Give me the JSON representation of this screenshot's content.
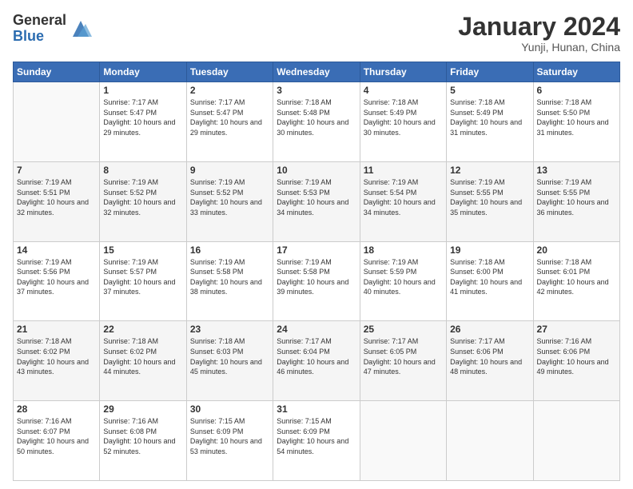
{
  "header": {
    "logo_general": "General",
    "logo_blue": "Blue",
    "month_title": "January 2024",
    "location": "Yunji, Hunan, China"
  },
  "calendar": {
    "days_of_week": [
      "Sunday",
      "Monday",
      "Tuesday",
      "Wednesday",
      "Thursday",
      "Friday",
      "Saturday"
    ],
    "weeks": [
      [
        {
          "day": "",
          "sunrise": "",
          "sunset": "",
          "daylight": ""
        },
        {
          "day": "1",
          "sunrise": "Sunrise: 7:17 AM",
          "sunset": "Sunset: 5:47 PM",
          "daylight": "Daylight: 10 hours and 29 minutes."
        },
        {
          "day": "2",
          "sunrise": "Sunrise: 7:17 AM",
          "sunset": "Sunset: 5:47 PM",
          "daylight": "Daylight: 10 hours and 29 minutes."
        },
        {
          "day": "3",
          "sunrise": "Sunrise: 7:18 AM",
          "sunset": "Sunset: 5:48 PM",
          "daylight": "Daylight: 10 hours and 30 minutes."
        },
        {
          "day": "4",
          "sunrise": "Sunrise: 7:18 AM",
          "sunset": "Sunset: 5:49 PM",
          "daylight": "Daylight: 10 hours and 30 minutes."
        },
        {
          "day": "5",
          "sunrise": "Sunrise: 7:18 AM",
          "sunset": "Sunset: 5:49 PM",
          "daylight": "Daylight: 10 hours and 31 minutes."
        },
        {
          "day": "6",
          "sunrise": "Sunrise: 7:18 AM",
          "sunset": "Sunset: 5:50 PM",
          "daylight": "Daylight: 10 hours and 31 minutes."
        }
      ],
      [
        {
          "day": "7",
          "sunrise": "Sunrise: 7:19 AM",
          "sunset": "Sunset: 5:51 PM",
          "daylight": "Daylight: 10 hours and 32 minutes."
        },
        {
          "day": "8",
          "sunrise": "Sunrise: 7:19 AM",
          "sunset": "Sunset: 5:52 PM",
          "daylight": "Daylight: 10 hours and 32 minutes."
        },
        {
          "day": "9",
          "sunrise": "Sunrise: 7:19 AM",
          "sunset": "Sunset: 5:52 PM",
          "daylight": "Daylight: 10 hours and 33 minutes."
        },
        {
          "day": "10",
          "sunrise": "Sunrise: 7:19 AM",
          "sunset": "Sunset: 5:53 PM",
          "daylight": "Daylight: 10 hours and 34 minutes."
        },
        {
          "day": "11",
          "sunrise": "Sunrise: 7:19 AM",
          "sunset": "Sunset: 5:54 PM",
          "daylight": "Daylight: 10 hours and 34 minutes."
        },
        {
          "day": "12",
          "sunrise": "Sunrise: 7:19 AM",
          "sunset": "Sunset: 5:55 PM",
          "daylight": "Daylight: 10 hours and 35 minutes."
        },
        {
          "day": "13",
          "sunrise": "Sunrise: 7:19 AM",
          "sunset": "Sunset: 5:55 PM",
          "daylight": "Daylight: 10 hours and 36 minutes."
        }
      ],
      [
        {
          "day": "14",
          "sunrise": "Sunrise: 7:19 AM",
          "sunset": "Sunset: 5:56 PM",
          "daylight": "Daylight: 10 hours and 37 minutes."
        },
        {
          "day": "15",
          "sunrise": "Sunrise: 7:19 AM",
          "sunset": "Sunset: 5:57 PM",
          "daylight": "Daylight: 10 hours and 37 minutes."
        },
        {
          "day": "16",
          "sunrise": "Sunrise: 7:19 AM",
          "sunset": "Sunset: 5:58 PM",
          "daylight": "Daylight: 10 hours and 38 minutes."
        },
        {
          "day": "17",
          "sunrise": "Sunrise: 7:19 AM",
          "sunset": "Sunset: 5:58 PM",
          "daylight": "Daylight: 10 hours and 39 minutes."
        },
        {
          "day": "18",
          "sunrise": "Sunrise: 7:19 AM",
          "sunset": "Sunset: 5:59 PM",
          "daylight": "Daylight: 10 hours and 40 minutes."
        },
        {
          "day": "19",
          "sunrise": "Sunrise: 7:18 AM",
          "sunset": "Sunset: 6:00 PM",
          "daylight": "Daylight: 10 hours and 41 minutes."
        },
        {
          "day": "20",
          "sunrise": "Sunrise: 7:18 AM",
          "sunset": "Sunset: 6:01 PM",
          "daylight": "Daylight: 10 hours and 42 minutes."
        }
      ],
      [
        {
          "day": "21",
          "sunrise": "Sunrise: 7:18 AM",
          "sunset": "Sunset: 6:02 PM",
          "daylight": "Daylight: 10 hours and 43 minutes."
        },
        {
          "day": "22",
          "sunrise": "Sunrise: 7:18 AM",
          "sunset": "Sunset: 6:02 PM",
          "daylight": "Daylight: 10 hours and 44 minutes."
        },
        {
          "day": "23",
          "sunrise": "Sunrise: 7:18 AM",
          "sunset": "Sunset: 6:03 PM",
          "daylight": "Daylight: 10 hours and 45 minutes."
        },
        {
          "day": "24",
          "sunrise": "Sunrise: 7:17 AM",
          "sunset": "Sunset: 6:04 PM",
          "daylight": "Daylight: 10 hours and 46 minutes."
        },
        {
          "day": "25",
          "sunrise": "Sunrise: 7:17 AM",
          "sunset": "Sunset: 6:05 PM",
          "daylight": "Daylight: 10 hours and 47 minutes."
        },
        {
          "day": "26",
          "sunrise": "Sunrise: 7:17 AM",
          "sunset": "Sunset: 6:06 PM",
          "daylight": "Daylight: 10 hours and 48 minutes."
        },
        {
          "day": "27",
          "sunrise": "Sunrise: 7:16 AM",
          "sunset": "Sunset: 6:06 PM",
          "daylight": "Daylight: 10 hours and 49 minutes."
        }
      ],
      [
        {
          "day": "28",
          "sunrise": "Sunrise: 7:16 AM",
          "sunset": "Sunset: 6:07 PM",
          "daylight": "Daylight: 10 hours and 50 minutes."
        },
        {
          "day": "29",
          "sunrise": "Sunrise: 7:16 AM",
          "sunset": "Sunset: 6:08 PM",
          "daylight": "Daylight: 10 hours and 52 minutes."
        },
        {
          "day": "30",
          "sunrise": "Sunrise: 7:15 AM",
          "sunset": "Sunset: 6:09 PM",
          "daylight": "Daylight: 10 hours and 53 minutes."
        },
        {
          "day": "31",
          "sunrise": "Sunrise: 7:15 AM",
          "sunset": "Sunset: 6:09 PM",
          "daylight": "Daylight: 10 hours and 54 minutes."
        },
        {
          "day": "",
          "sunrise": "",
          "sunset": "",
          "daylight": ""
        },
        {
          "day": "",
          "sunrise": "",
          "sunset": "",
          "daylight": ""
        },
        {
          "day": "",
          "sunrise": "",
          "sunset": "",
          "daylight": ""
        }
      ]
    ]
  }
}
